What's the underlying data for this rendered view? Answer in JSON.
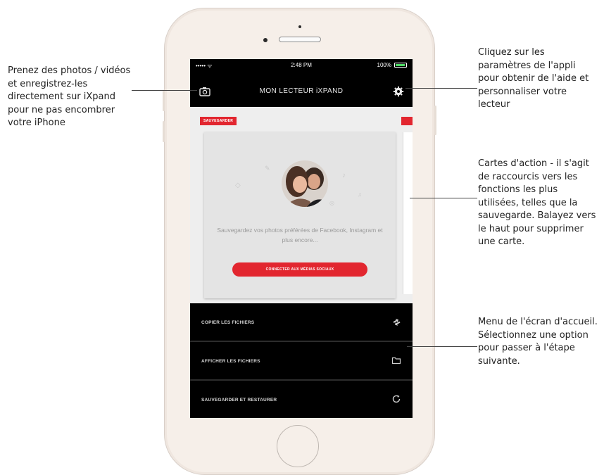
{
  "callouts": {
    "left": "Prenez des photos / vidéos et enregistrez-les directement sur iXpand pour ne pas encombrer votre iPhone",
    "settings": "Cliquez sur les paramètres de l'appli pour obtenir de l'aide et personnaliser votre lecteur",
    "cards": "Cartes d'action - il s'agit de raccourcis vers les fonctions les plus utilisées, telles que la sauvegarde. Balayez vers le haut pour supprimer une carte.",
    "menu": "Menu de l'écran d'accueil. Sélectionnez une option pour passer à l'étape suivante."
  },
  "status_bar": {
    "signal": "••••• ᯤ",
    "time": "2:48 PM",
    "battery": "100%"
  },
  "app": {
    "title": "MON LECTEUR iXPAND"
  },
  "card": {
    "tag": "SAUVEGARDER",
    "text": "Sauvegardez vos photos préférées de Facebook, Instagram et plus encore...",
    "button_label": "CONNECTER AUX MÉDIAS SOCIAUX"
  },
  "menu": {
    "items": [
      {
        "label": "COPIER LES FICHIERS",
        "icon": "transfer-icon"
      },
      {
        "label": "AFFICHER LES FICHIERS",
        "icon": "folder-icon"
      },
      {
        "label": "SAUVEGARDER ET RESTAURER",
        "icon": "refresh-icon"
      }
    ]
  },
  "colors": {
    "accent": "#e2262f",
    "screen_bg": "#000000",
    "card_area": "#eeeeee",
    "phone_body": "#f6efe9"
  }
}
